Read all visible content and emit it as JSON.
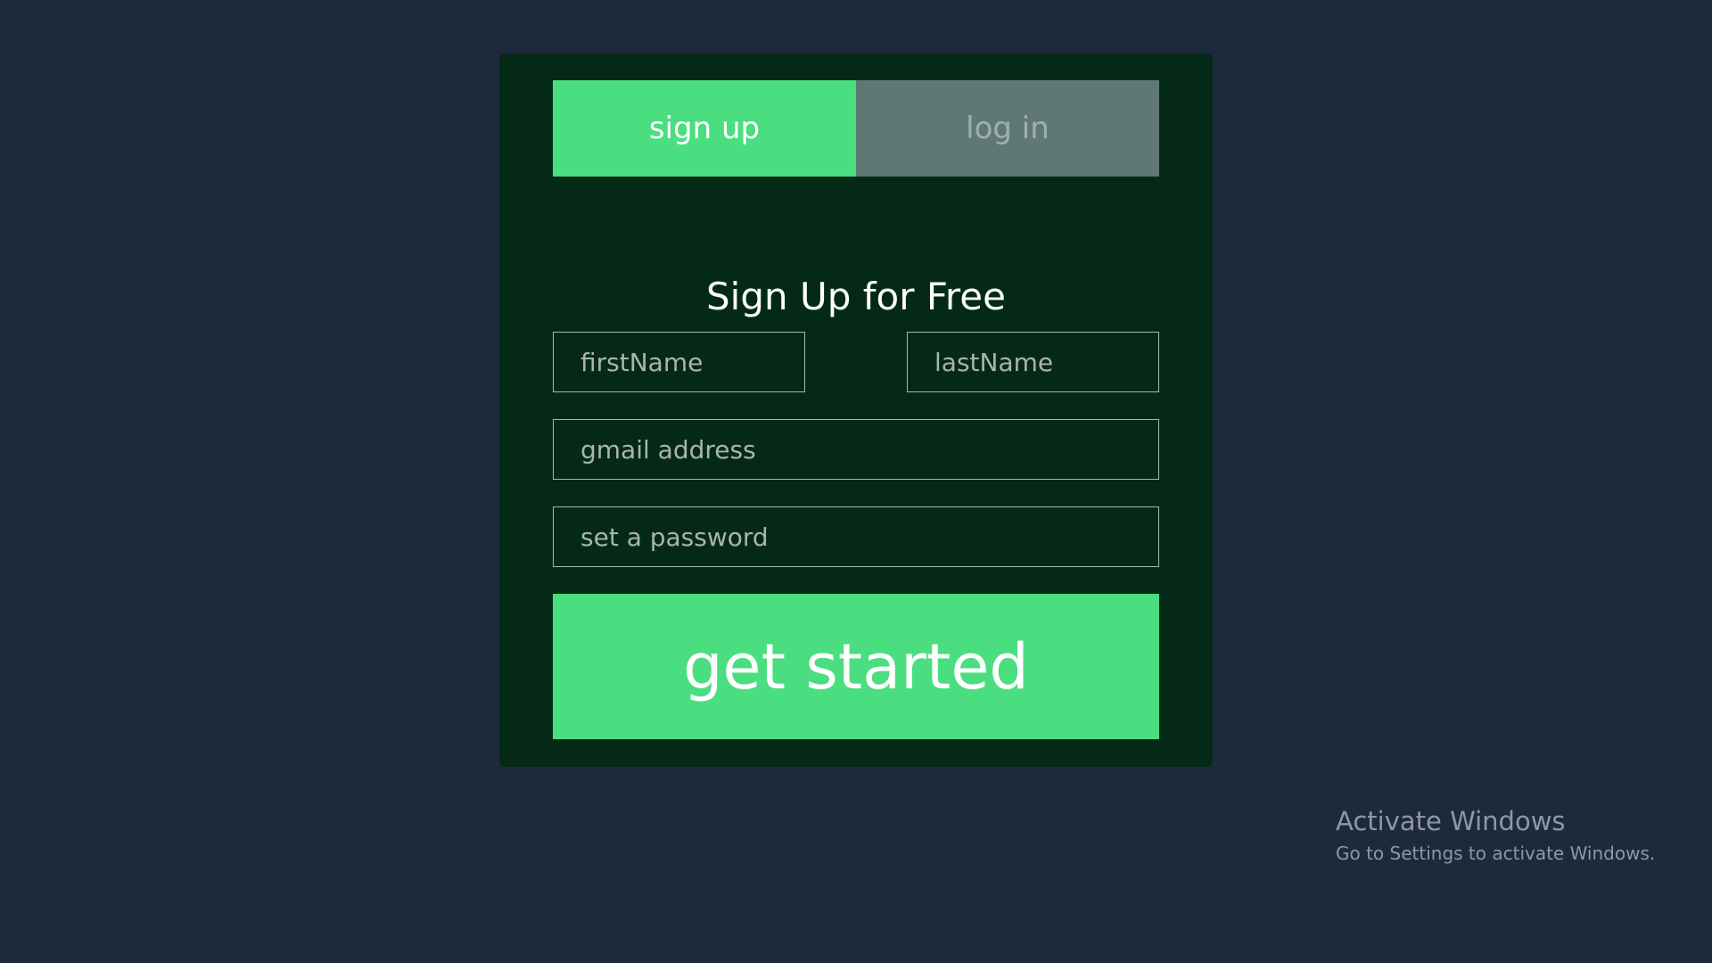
{
  "tabs": {
    "signup_label": "sign up",
    "login_label": "log in",
    "active": "signup"
  },
  "form": {
    "title": "Sign Up for Free",
    "first_name_placeholder": "firstName",
    "last_name_placeholder": "lastName",
    "email_placeholder": "gmail address",
    "password_placeholder": "set a password",
    "submit_label": "get started"
  },
  "watermark": {
    "title": "Activate Windows",
    "subtitle": "Go to Settings to activate Windows."
  },
  "colors": {
    "page_background": "#1e2a3b",
    "card_background": "#042a17",
    "accent": "#4ade80",
    "inactive_tab": "#607874"
  }
}
